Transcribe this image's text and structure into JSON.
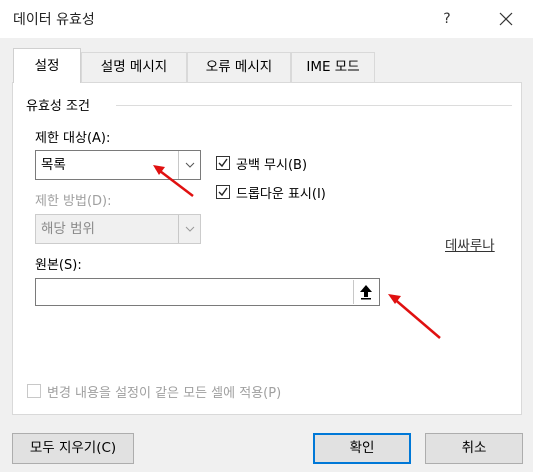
{
  "window": {
    "title": "데이터 유효성",
    "help_label": "?"
  },
  "tabs": [
    {
      "label": "설정",
      "active": true
    },
    {
      "label": "설명 메시지",
      "active": false
    },
    {
      "label": "오류 메시지",
      "active": false
    },
    {
      "label": "IME 모드",
      "active": false
    }
  ],
  "settings": {
    "group_title": "유효성 조건",
    "allow_label": "제한 대상(A):",
    "allow_value": "목록",
    "ignore_blank_label": "공백 무시(B)",
    "ignore_blank_checked": true,
    "dropdown_label": "드롭다운 표시(I)",
    "dropdown_checked": true,
    "data_label": "제한 방법(D):",
    "data_value": "해당 범위",
    "data_disabled": true,
    "side_link": "데싸루나",
    "source_label": "원본(S):",
    "source_value": "",
    "apply_all_label": "변경 내용을 설정이 같은 모든 셀에 적용(P)",
    "apply_all_checked": false,
    "apply_all_disabled": true
  },
  "buttons": {
    "clear_all": "모두 지우기(C)",
    "ok": "확인",
    "cancel": "취소"
  },
  "colors": {
    "arrow": "#e01010",
    "default_button_border": "#0078d7"
  }
}
